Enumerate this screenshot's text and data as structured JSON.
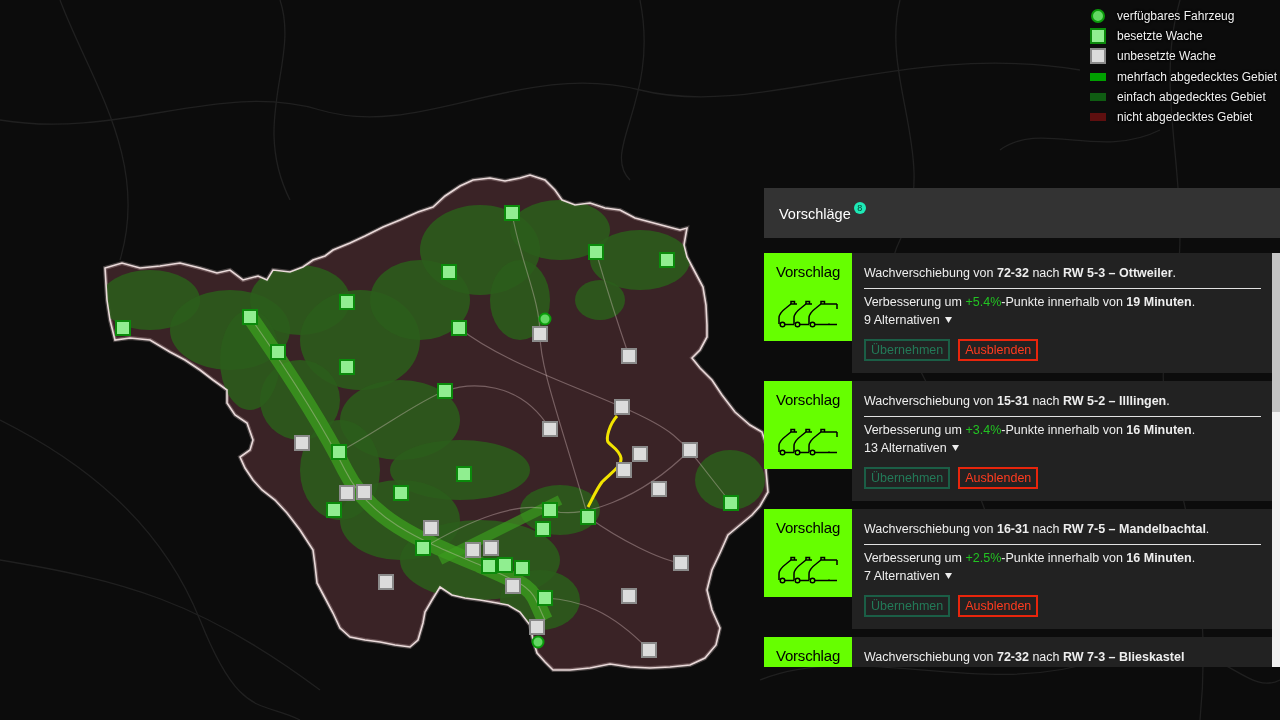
{
  "legend": [
    {
      "kind": "vehicle",
      "label": "verfügbares Fahrzeug"
    },
    {
      "kind": "staffed",
      "label": "besetzte Wache"
    },
    {
      "kind": "unstaffed",
      "label": "unbesetzte Wache"
    },
    {
      "kind": "area",
      "color": "#00a000",
      "label": "mehrfach abgedecktes Gebiet"
    },
    {
      "kind": "area",
      "color": "#0f5c12",
      "label": "einfach abgedecktes Gebiet"
    },
    {
      "kind": "area",
      "color": "#5e0f0f",
      "label": "nicht abgedecktes Gebiet"
    }
  ],
  "map": {
    "markers": [
      {
        "kind": "staffed"
      },
      {
        "kind": "staffed"
      },
      {
        "kind": "staffed"
      },
      {
        "kind": "staffed"
      },
      {
        "kind": "staffed"
      },
      {
        "kind": "staffed"
      },
      {
        "kind": "vehicle"
      },
      {
        "kind": "staffed"
      },
      {
        "kind": "staffed"
      },
      {
        "kind": "unstaffed"
      },
      {
        "kind": "staffed"
      },
      {
        "kind": "unstaffed"
      },
      {
        "kind": "staffed"
      },
      {
        "kind": "staffed"
      },
      {
        "kind": "unstaffed"
      },
      {
        "kind": "unstaffed"
      },
      {
        "kind": "unstaffed"
      },
      {
        "kind": "unstaffed"
      },
      {
        "kind": "staffed"
      },
      {
        "kind": "unstaffed"
      },
      {
        "kind": "unstaffed"
      },
      {
        "kind": "staffed"
      },
      {
        "kind": "unstaffed"
      },
      {
        "kind": "unstaffed"
      },
      {
        "kind": "unstaffed"
      },
      {
        "kind": "staffed"
      },
      {
        "kind": "staffed"
      },
      {
        "kind": "staffed"
      },
      {
        "kind": "staffed"
      },
      {
        "kind": "staffed"
      },
      {
        "kind": "unstaffed"
      },
      {
        "kind": "staffed"
      },
      {
        "kind": "staffed"
      },
      {
        "kind": "unstaffed"
      },
      {
        "kind": "unstaffed"
      },
      {
        "kind": "staffed"
      },
      {
        "kind": "unstaffed"
      },
      {
        "kind": "staffed"
      },
      {
        "kind": "staffed"
      },
      {
        "kind": "unstaffed"
      },
      {
        "kind": "unstaffed"
      },
      {
        "kind": "unstaffed"
      },
      {
        "kind": "staffed"
      },
      {
        "kind": "unstaffed"
      },
      {
        "kind": "vehicle"
      },
      {
        "kind": "unstaffed"
      }
    ]
  },
  "panel": {
    "title": "Vorschläge",
    "badge": "8",
    "cards": [
      {
        "tile_label": "Vorschlag",
        "title": "Wachverschiebung von **72-32** nach **RW 5-3 – Ottweiler**.",
        "improvement": {
          "before": "Verbesserung um ",
          "gain": "+5.4%",
          "after": "-Punkte innerhalb von **19 Minuten**."
        },
        "alternatives": "9 Alternativen",
        "actions": [
          {
            "kind": "accept",
            "label": "Übernehmen"
          },
          {
            "kind": "dismiss",
            "label": "Ausblenden"
          }
        ]
      },
      {
        "tile_label": "Vorschlag",
        "title": "Wachverschiebung von **15-31** nach **RW 5-2 – Illlingen**.",
        "improvement": {
          "before": "Verbesserung um ",
          "gain": "+3.4%",
          "after": "-Punkte innerhalb von **16 Minuten**."
        },
        "alternatives": "13 Alternativen",
        "actions": [
          {
            "kind": "accept",
            "label": "Übernehmen"
          },
          {
            "kind": "dismiss",
            "label": "Ausblenden"
          }
        ]
      },
      {
        "tile_label": "Vorschlag",
        "title": "Wachverschiebung von **16-31** nach **RW 7-5 – Mandelbachtal**.",
        "improvement": {
          "before": "Verbesserung um ",
          "gain": "+2.5%",
          "after": "-Punkte innerhalb von **16 Minuten**."
        },
        "alternatives": "7 Alternativen",
        "actions": [
          {
            "kind": "accept",
            "label": "Übernehmen"
          },
          {
            "kind": "dismiss",
            "label": "Ausblenden"
          }
        ]
      },
      {
        "tile_label": "Vorschlag",
        "title": "Wachverschiebung von **72-32** nach **RW 7-3 – Blieskastel**"
      }
    ]
  }
}
